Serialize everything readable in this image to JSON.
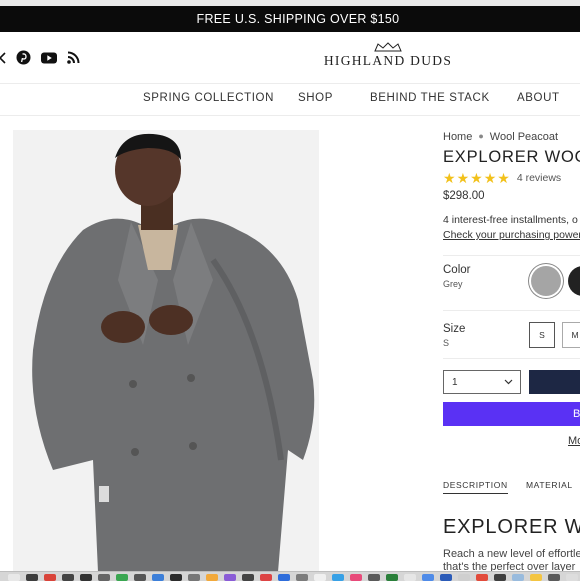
{
  "announcement": "FREE U.S. SHIPPING OVER $150",
  "social": [
    "x-icon",
    "pinterest-icon",
    "youtube-icon",
    "rss-icon"
  ],
  "logo": {
    "text": "HIGHLAND DUDS"
  },
  "nav": [
    "SPRING COLLECTION",
    "SHOP",
    "BEHIND THE STACK",
    "ABOUT"
  ],
  "breadcrumb": {
    "home": "Home",
    "current": "Wool Peacoat"
  },
  "product": {
    "title": "EXPLORER WOO",
    "rating": 5,
    "reviews": "4 reviews",
    "price": "$298.00",
    "installments": "4 interest-free installments, o",
    "purchasing_link": "Check your purchasing power"
  },
  "color": {
    "label": "Color",
    "value": "Grey",
    "swatches": [
      "#a5a5a5",
      "#222222"
    ]
  },
  "size": {
    "label": "Size",
    "value": "S",
    "options": [
      "S",
      "M"
    ]
  },
  "quantity": "1",
  "buy_now_label": "B",
  "more_options": "Mo",
  "tabs": [
    "DESCRIPTION",
    "MATERIAL"
  ],
  "description": {
    "heading": "EXPLORER W",
    "line1": "Reach a new level of effortle",
    "line2": "that's the perfect over layer"
  },
  "colors": {
    "accent_buy": "#5a31f4",
    "cart_navy": "#1d2744",
    "star": "#f2c11b"
  }
}
